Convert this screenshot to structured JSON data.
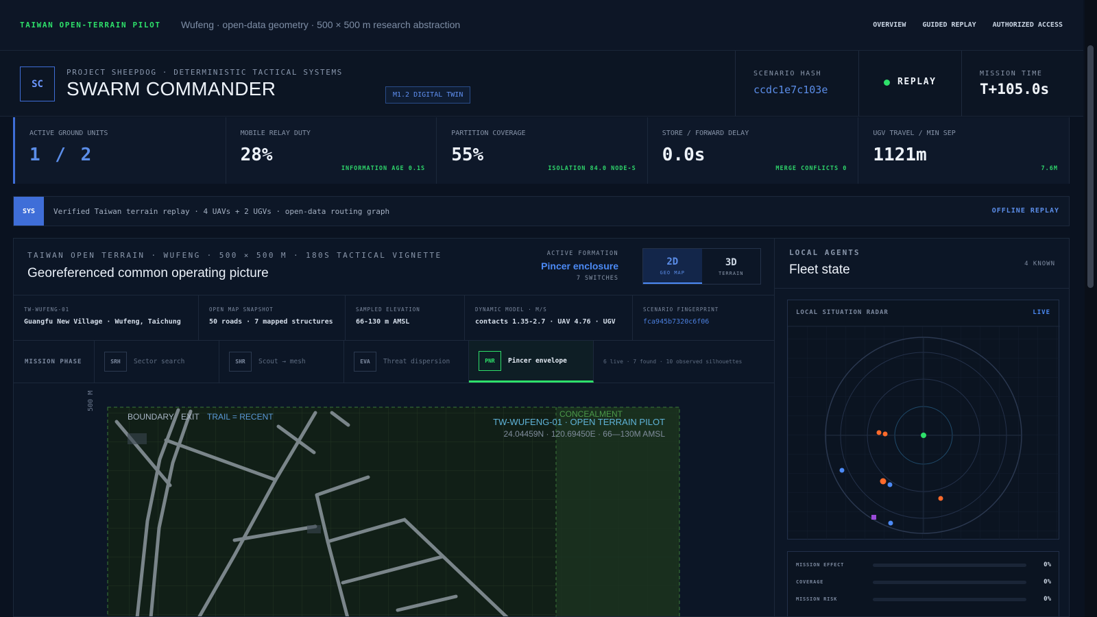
{
  "nav": {
    "brand": "TAIWAN OPEN-TERRAIN PILOT",
    "subtitle": "Wufeng · open-data geometry · 500 × 500 m research abstraction",
    "links": [
      "OVERVIEW",
      "GUIDED REPLAY",
      "AUTHORIZED ACCESS"
    ]
  },
  "header": {
    "logo": "SC",
    "project": "PROJECT SHEEPDOG · DETERMINISTIC TACTICAL SYSTEMS",
    "title": "SWARM COMMANDER",
    "badge": "M1.2 DIGITAL TWIN",
    "scenario_hash_label": "SCENARIO HASH",
    "scenario_hash": "ccdc1e7c103e",
    "status": "REPLAY",
    "status_color": "#2ee06a",
    "mission_time_label": "MISSION TIME",
    "mission_time": "T+105.0s"
  },
  "kpis": [
    {
      "label": "ACTIVE GROUND UNITS",
      "value": "1 / 2",
      "note": ""
    },
    {
      "label": "MOBILE RELAY DUTY",
      "value": "28%",
      "note": "INFORMATION AGE 0.1S"
    },
    {
      "label": "PARTITION COVERAGE",
      "value": "55%",
      "note": "ISOLATION 84.0 NODE-S"
    },
    {
      "label": "STORE / FORWARD DELAY",
      "value": "0.0s",
      "note": "MERGE CONFLICTS 0"
    },
    {
      "label": "UGV TRAVEL / MIN SEP",
      "value": "1121m",
      "note": "7.6M"
    }
  ],
  "sysbar": {
    "tag": "SYS",
    "message": "Verified Taiwan terrain replay · 4 UAVs + 2 UGVs · open-data routing graph",
    "right": "OFFLINE REPLAY"
  },
  "main": {
    "caps": "TAIWAN OPEN TERRAIN · WUFENG · 500 × 500 M · 180S TACTICAL VIGNETTE",
    "title": "Georeferenced common operating picture",
    "formation_label": "ACTIVE FORMATION",
    "formation": "Pincer enclosure",
    "switches": "7 SWITCHES",
    "toggle": [
      {
        "big": "2D",
        "small": "GEO MAP"
      },
      {
        "big": "3D",
        "small": "TERRAIN"
      }
    ],
    "info": [
      {
        "k": "TW-WUFENG-01",
        "v": "Guangfu New Village · Wufeng, Taichung"
      },
      {
        "k": "OPEN MAP SNAPSHOT",
        "v": "50 roads · 7 mapped structures"
      },
      {
        "k": "SAMPLED ELEVATION",
        "v": "66-130 m AMSL"
      },
      {
        "k": "DYNAMIC MODEL · M/S",
        "v": "contacts 1.35-2.7 · UAV 4.76 · UGV"
      },
      {
        "k": "SCENARIO FINGERPRINT",
        "v": "fca945b7320c6f06"
      }
    ],
    "phase_label": "MISSION PHASE",
    "phases": [
      {
        "code": "SRH",
        "name": "Sector search"
      },
      {
        "code": "SHR",
        "name": "Scout → mesh"
      },
      {
        "code": "EVA",
        "name": "Threat dispersion"
      },
      {
        "code": "PNR",
        "name": "Pincer envelope"
      }
    ],
    "phase_status": "6 live · 7 found · 10 observed silhouettes",
    "map": {
      "scale": "500 M",
      "legend_a": "BOUNDARY",
      "legend_b": "EXIT",
      "legend_c": "TRAIL = RECENT",
      "concealment": "CONCEALMENT",
      "site": "TW-WUFENG-01 · OPEN TERRAIN PILOT",
      "coords": "24.04459N · 120.69450E · 66—130M AMSL"
    }
  },
  "agents": {
    "caps": "LOCAL AGENTS",
    "title": "Fleet state",
    "known": "4 KNOWN",
    "radar_label": "LOCAL SITUATION RADAR",
    "radar_live": "LIVE",
    "metrics": [
      {
        "label": "MISSION EFFECT",
        "value": "0%",
        "fraction": 0
      },
      {
        "label": "COVERAGE",
        "value": "0%",
        "fraction": 0
      },
      {
        "label": "MISSION RISK",
        "value": "0%",
        "fraction": 0
      }
    ]
  },
  "colors": {
    "accent": "#3f6ed8",
    "friendly": "#2ee06a",
    "contact": "#ff6a2b",
    "uav": "#4c8af5",
    "unknown": "#9a4ad8"
  }
}
